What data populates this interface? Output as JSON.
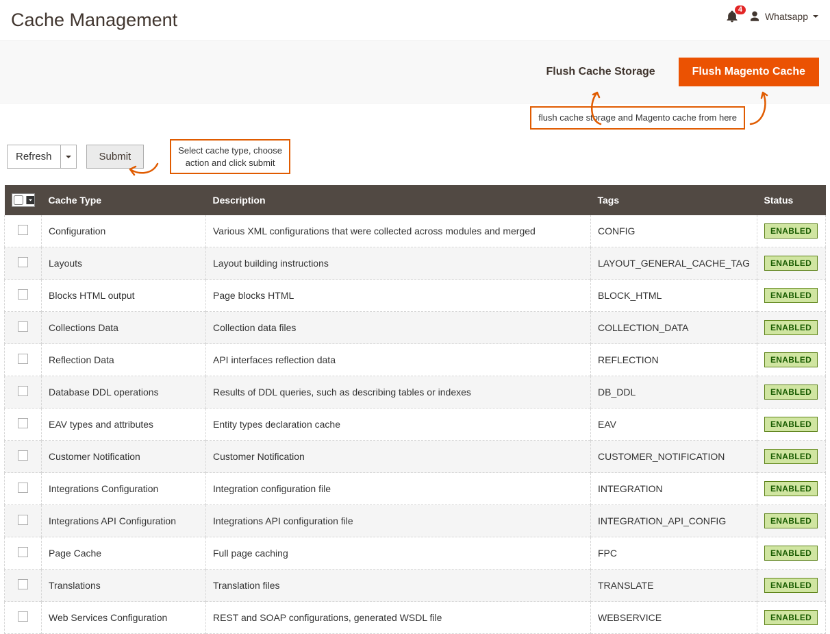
{
  "header": {
    "title": "Cache Management",
    "notif_count": "4",
    "username": "Whatsapp"
  },
  "actions": {
    "flush_storage": "Flush Cache Storage",
    "flush_magento": "Flush Magento Cache"
  },
  "annotations": {
    "flush_hint": "flush cache storage and Magento cache from here",
    "submit_hint_l1": "Select cache type, choose",
    "submit_hint_l2": "action and click submit"
  },
  "toolbar": {
    "action_label": "Refresh",
    "submit_label": "Submit"
  },
  "table": {
    "headers": {
      "type": "Cache Type",
      "desc": "Description",
      "tags": "Tags",
      "status": "Status"
    },
    "rows": [
      {
        "type": "Configuration",
        "desc": "Various XML configurations that were collected across modules and merged",
        "tags": "CONFIG",
        "status": "ENABLED"
      },
      {
        "type": "Layouts",
        "desc": "Layout building instructions",
        "tags": "LAYOUT_GENERAL_CACHE_TAG",
        "status": "ENABLED"
      },
      {
        "type": "Blocks HTML output",
        "desc": "Page blocks HTML",
        "tags": "BLOCK_HTML",
        "status": "ENABLED"
      },
      {
        "type": "Collections Data",
        "desc": "Collection data files",
        "tags": "COLLECTION_DATA",
        "status": "ENABLED"
      },
      {
        "type": "Reflection Data",
        "desc": "API interfaces reflection data",
        "tags": "REFLECTION",
        "status": "ENABLED"
      },
      {
        "type": "Database DDL operations",
        "desc": "Results of DDL queries, such as describing tables or indexes",
        "tags": "DB_DDL",
        "status": "ENABLED"
      },
      {
        "type": "EAV types and attributes",
        "desc": "Entity types declaration cache",
        "tags": "EAV",
        "status": "ENABLED"
      },
      {
        "type": "Customer Notification",
        "desc": "Customer Notification",
        "tags": "CUSTOMER_NOTIFICATION",
        "status": "ENABLED"
      },
      {
        "type": "Integrations Configuration",
        "desc": "Integration configuration file",
        "tags": "INTEGRATION",
        "status": "ENABLED"
      },
      {
        "type": "Integrations API Configuration",
        "desc": "Integrations API configuration file",
        "tags": "INTEGRATION_API_CONFIG",
        "status": "ENABLED"
      },
      {
        "type": "Page Cache",
        "desc": "Full page caching",
        "tags": "FPC",
        "status": "ENABLED"
      },
      {
        "type": "Translations",
        "desc": "Translation files",
        "tags": "TRANSLATE",
        "status": "ENABLED"
      },
      {
        "type": "Web Services Configuration",
        "desc": "REST and SOAP configurations, generated WSDL file",
        "tags": "WEBSERVICE",
        "status": "ENABLED"
      }
    ]
  }
}
